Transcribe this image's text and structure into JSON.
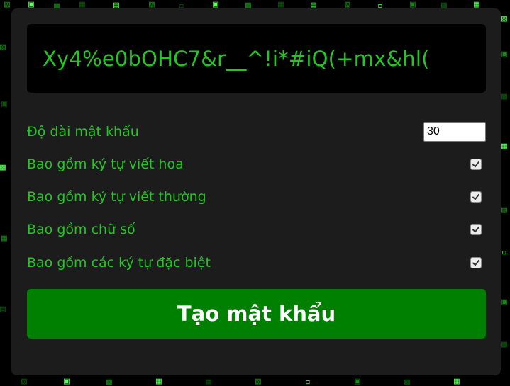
{
  "password": {
    "value": "Xy4%e0bOHC7&r__^!i*#iQ(+mx&hl("
  },
  "options": [
    {
      "label": "Độ dài mật khẩu",
      "type": "number",
      "value": "30"
    },
    {
      "label": "Bao gồm ký tự viết hoa",
      "type": "checkbox",
      "checked": true
    },
    {
      "label": "Bao gồm ký tự viết thường",
      "type": "checkbox",
      "checked": true
    },
    {
      "label": "Bao gồm chữ số",
      "type": "checkbox",
      "checked": true
    },
    {
      "label": "Bao gồm các ký tự đặc biệt",
      "type": "checkbox",
      "checked": true
    }
  ],
  "generate_button": {
    "label": "Tạo mật khẩu"
  },
  "colors": {
    "text_green": "#22c722",
    "button_green": "#008000",
    "panel_bg": "#1c1c1c",
    "page_bg": "#000000"
  },
  "icons": {
    "checkbox_checked": "check-icon"
  }
}
